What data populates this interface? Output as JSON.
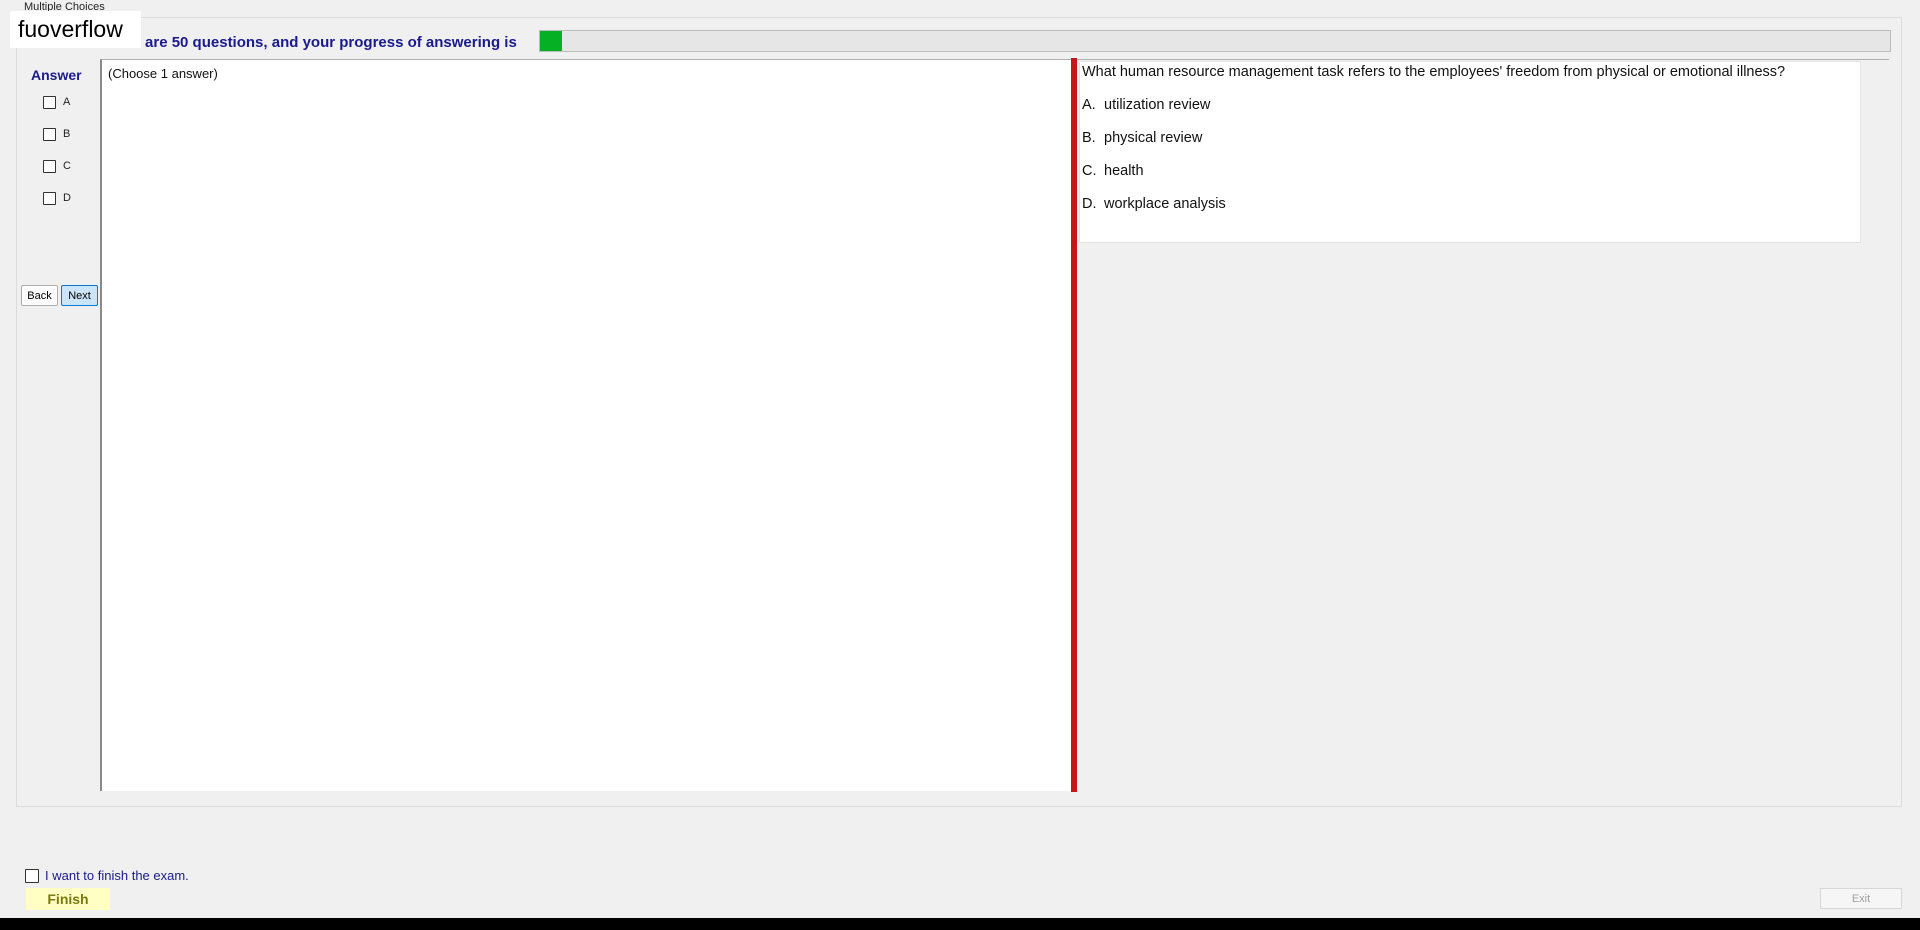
{
  "watermark": "fuoverflow",
  "group_label": "Multiple Choices",
  "progress": {
    "text": "There are 50 questions, and your progress of answering is",
    "fill_fraction": 0.016,
    "fill_color": "#06b025"
  },
  "answer_panel": {
    "title": "Answer",
    "choices": [
      "A",
      "B",
      "C",
      "D"
    ],
    "back_label": "Back",
    "next_label": "Next"
  },
  "instruction": "(Choose 1 answer)",
  "question": {
    "text": "What human resource management task refers to the employees' freedom from physical or emotional illness?",
    "options": [
      {
        "letter": "A.",
        "text": "utilization review"
      },
      {
        "letter": "B.",
        "text": "physical review"
      },
      {
        "letter": "C.",
        "text": "health"
      },
      {
        "letter": "D.",
        "text": "workplace analysis"
      }
    ]
  },
  "footer": {
    "finish_check_label": "I want to finish the exam.",
    "finish_label": "Finish",
    "exit_label": "Exit"
  },
  "colors": {
    "splitter": "#c4161c",
    "heading": "#1a1a8c"
  }
}
